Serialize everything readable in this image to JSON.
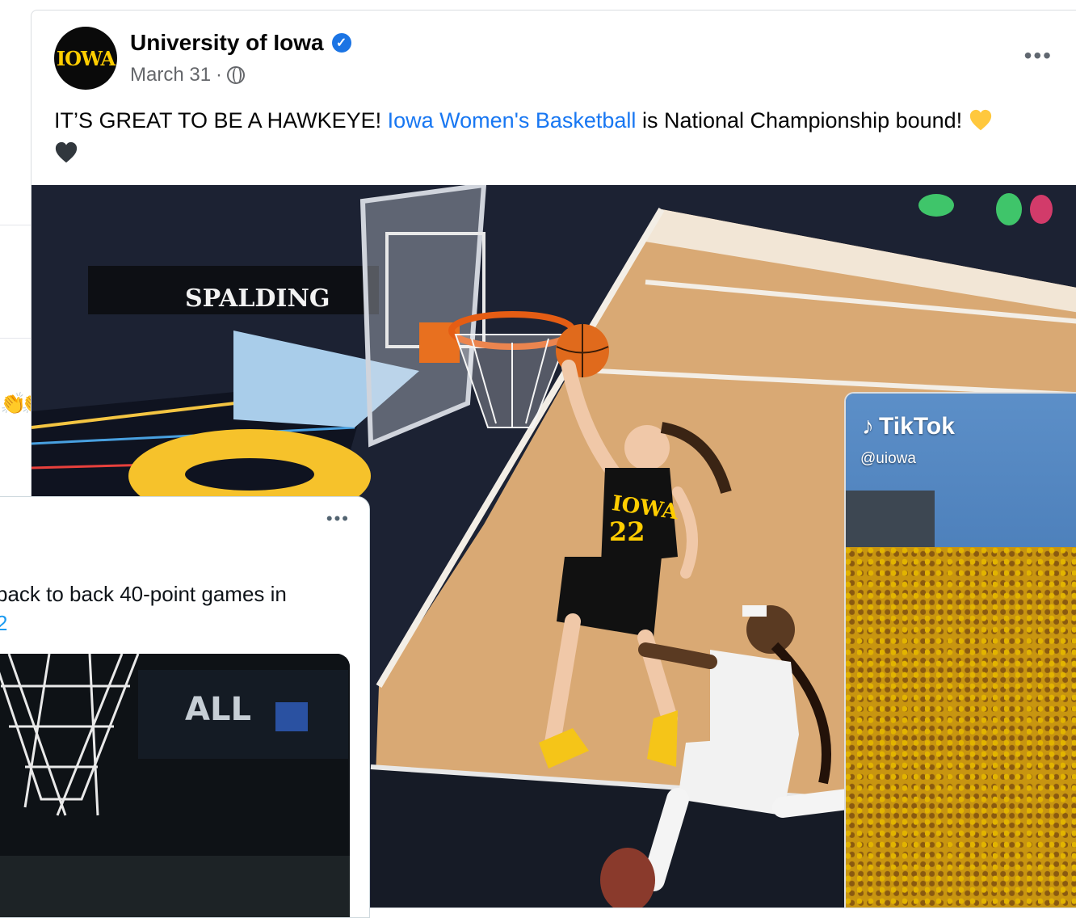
{
  "facebook_post": {
    "page_name": "University of Iowa",
    "avatar_text": "IOWA",
    "date": "March 31",
    "date_sep": " · ",
    "more": "•••",
    "text_before": "IT’S GREAT TO BE A HAWKEYE! ",
    "link_text": "Iowa Women's Basketball",
    "text_after": " is National Championship bound! ",
    "photo_signage": "SPALDING",
    "jersey_text": "IOWA",
    "jersey_number": "22"
  },
  "tiktok_overlay": {
    "brand": "TikTok",
    "handle": "@uiowa"
  },
  "twitter_card": {
    "more": "•••",
    "text": " back to back 40-point games in",
    "link_fragment": "2",
    "image_signage": "ALL"
  },
  "colors": {
    "facebook_link": "#1877f2",
    "twitter_link": "#1d9bf0",
    "iowa_gold": "#ffcd00",
    "iowa_black": "#0a0a0a"
  }
}
